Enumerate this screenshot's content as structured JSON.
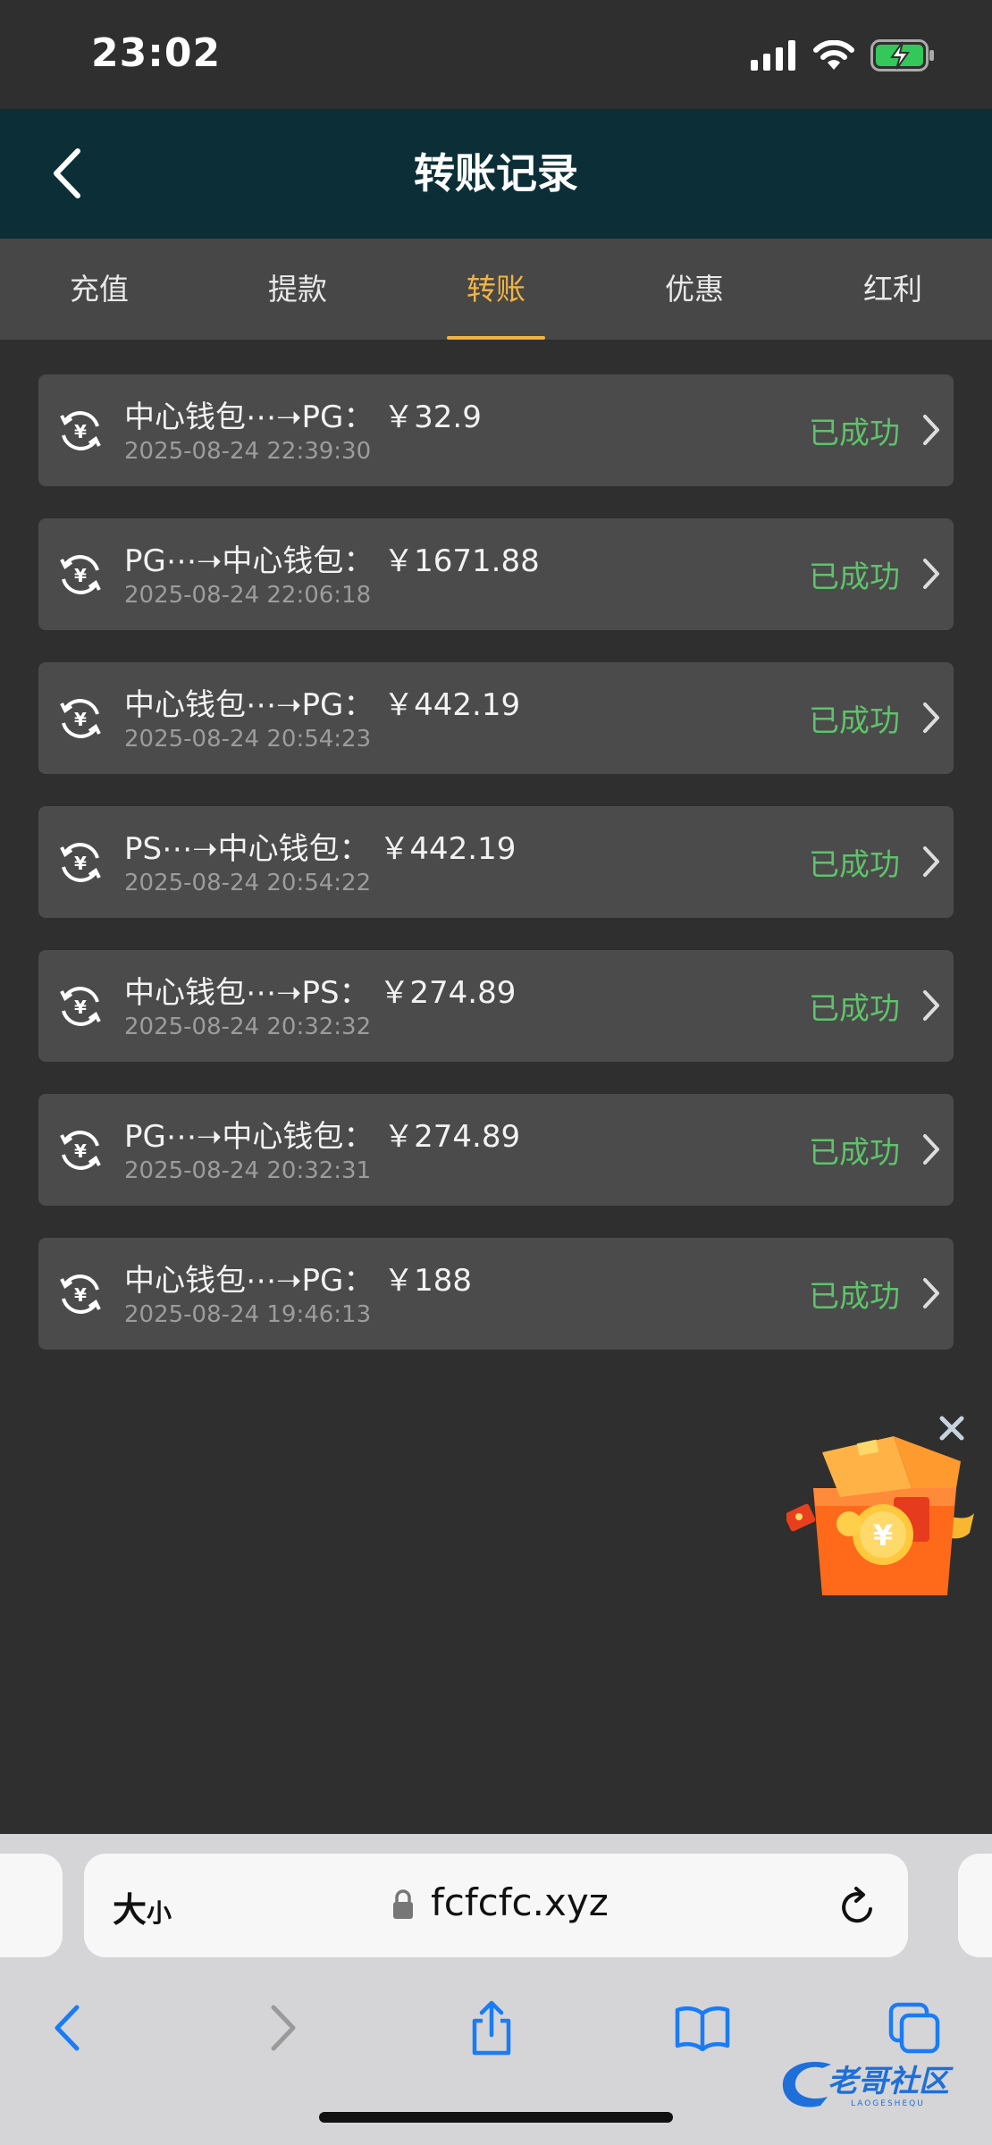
{
  "status_bar": {
    "time": "23:02"
  },
  "header": {
    "title": "转账记录"
  },
  "tabs": [
    {
      "label": "充值",
      "active": false
    },
    {
      "label": "提款",
      "active": false
    },
    {
      "label": "转账",
      "active": true
    },
    {
      "label": "优惠",
      "active": false
    },
    {
      "label": "红利",
      "active": false
    }
  ],
  "records": [
    {
      "title": "中心钱包⋯➝PG： ￥32.9",
      "time": "2025-08-24 22:39:30",
      "status": "已成功"
    },
    {
      "title": "PG⋯➝中心钱包： ￥1671.88",
      "time": "2025-08-24 22:06:18",
      "status": "已成功"
    },
    {
      "title": "中心钱包⋯➝PG： ￥442.19",
      "time": "2025-08-24 20:54:23",
      "status": "已成功"
    },
    {
      "title": "PS⋯➝中心钱包： ￥442.19",
      "time": "2025-08-24 20:54:22",
      "status": "已成功"
    },
    {
      "title": "中心钱包⋯➝PS： ￥274.89",
      "time": "2025-08-24 20:32:32",
      "status": "已成功"
    },
    {
      "title": "PG⋯➝中心钱包： ￥274.89",
      "time": "2025-08-24 20:32:31",
      "status": "已成功"
    },
    {
      "title": "中心钱包⋯➝PG： ￥188",
      "time": "2025-08-24 19:46:13",
      "status": "已成功"
    }
  ],
  "browser": {
    "text_size_big": "大",
    "text_size_small": "小",
    "url": "fcfcfc.xyz"
  },
  "watermark": {
    "text": "老哥社区",
    "sub": "LAOGESHEQU"
  },
  "colors": {
    "accent": "#f0b445",
    "success": "#5fc26b",
    "header_bg": "#0c2f37",
    "link_blue": "#1a7cf5"
  },
  "icons": {
    "back": "chevron-left-icon",
    "record": "yuan-transfer-icon",
    "row_arrow": "chevron-right-icon",
    "promo": "gift-box-icon",
    "lock": "lock-icon",
    "reload": "reload-icon"
  }
}
